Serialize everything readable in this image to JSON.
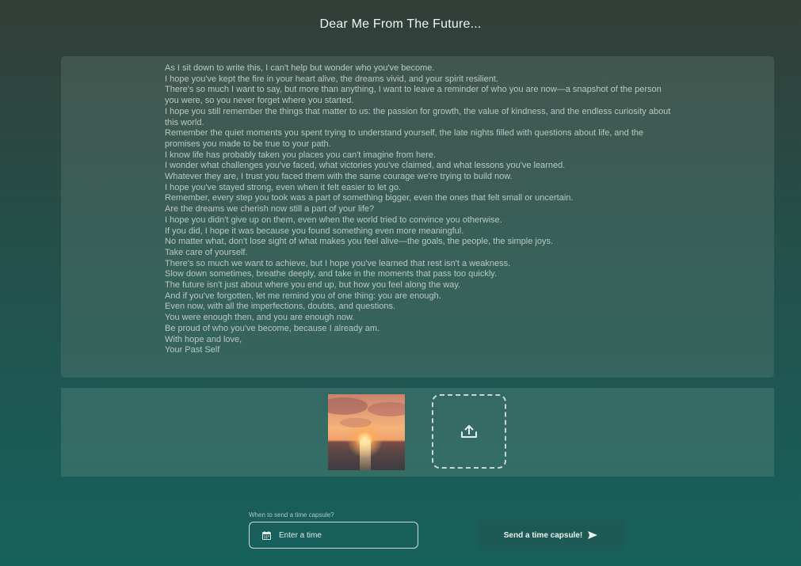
{
  "page_title": "Dear Me From The Future...",
  "letter": {
    "lines": [
      "As I sit down to write this, I can't help but wonder who you've become.",
      "I hope you've kept the fire in your heart alive, the dreams vivid, and your spirit resilient.",
      "There's so much I want to say, but more than anything, I want to leave a reminder of who you are now—a snapshot of the person you were, so you never forget where you started.",
      "I hope you still remember the things that matter to us: the passion for growth, the value of kindness, and the endless curiosity about this world.",
      "Remember the quiet moments you spent trying to understand yourself, the late nights filled with questions about life, and the promises you made to be true to your path.",
      "I know life has probably taken you places you can't imagine from here.",
      "I wonder what challenges you've faced, what victories you've claimed, and what lessons you've learned.",
      "Whatever they are, I trust you faced them with the same courage we're trying to build now.",
      "I hope you've stayed strong, even when it felt easier to let go.",
      "Remember, every step you took was a part of something bigger, even the ones that felt small or uncertain.",
      "Are the dreams we cherish now still a part of your life?",
      "I hope you didn't give up on them, even when the world tried to convince you otherwise.",
      "If you did, I hope it was because you found something even more meaningful.",
      "No matter what, don't lose sight of what makes you feel alive—the goals, the people, the simple joys.",
      "Take care of yourself.",
      "There's so much we want to achieve, but I hope you've learned that rest isn't a weakness.",
      "Slow down sometimes, breathe deeply, and take in the moments that pass too quickly.",
      "The future isn't just about where you end up, but how you feel along the way.",
      "And if you've forgotten, let me remind you of one thing: you are enough.",
      "Even now, with all the imperfections, doubts, and questions.",
      "You were enough then, and you are enough now.",
      "Be proud of who you've become, because I already am.",
      "With hope and love,",
      "Your Past Self"
    ]
  },
  "media": {
    "photo_icon": "sunset-photo",
    "upload_icon": "upload-icon"
  },
  "schedule": {
    "label": "When to send a time capsule?",
    "placeholder": "Enter a time",
    "calendar_icon": "calendar-icon"
  },
  "send_button": {
    "label": "Send a time capsule!",
    "icon": "send-arrow-icon"
  }
}
